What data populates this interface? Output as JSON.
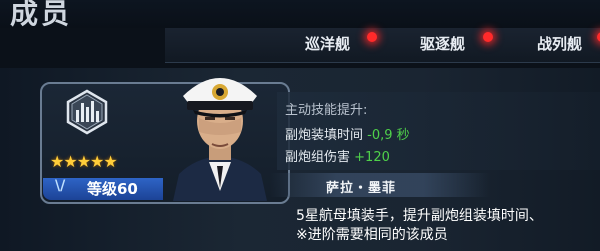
{
  "header": {
    "title": "成员"
  },
  "tabs": [
    {
      "label": "巡洋舰"
    },
    {
      "label": "驱逐舰"
    },
    {
      "label": "战列舰"
    }
  ],
  "crew": {
    "stars": "★★★★★",
    "level_mark": "\\/",
    "level": "等级60",
    "name": "萨拉・墨菲",
    "skill": {
      "heading": "主动技能提升:",
      "line1_label": "副炮装填时间",
      "line1_value": "-0,9 秒",
      "line2_label": "副炮组伤害",
      "line2_value": "+120"
    },
    "desc_line1": "5星航母填装手，提升副炮组装填时间、",
    "desc_line2": "※进阶需要相同的该成员"
  },
  "colors": {
    "accent_dot": "#ff2a2a",
    "value_green": "#4fd14a",
    "level_blue": "#2e64c6",
    "star": "#ffce3a"
  },
  "icons": {
    "class_emblem": "ship-class-emblem-icon",
    "level_mark": "rank-chevron-icon"
  }
}
